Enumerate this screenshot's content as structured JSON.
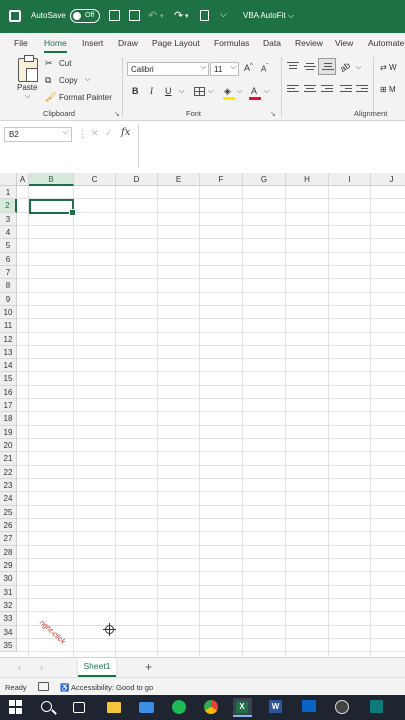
{
  "titlebar": {
    "autosave_label": "AutoSave",
    "autosave_state": "Off",
    "document_title": "VBA AutoFit ⌵"
  },
  "tabs": [
    {
      "label": "File",
      "active": false
    },
    {
      "label": "Home",
      "active": true
    },
    {
      "label": "Insert",
      "active": false
    },
    {
      "label": "Draw",
      "active": false
    },
    {
      "label": "Page Layout",
      "active": false
    },
    {
      "label": "Formulas",
      "active": false
    },
    {
      "label": "Data",
      "active": false
    },
    {
      "label": "Review",
      "active": false
    },
    {
      "label": "View",
      "active": false
    },
    {
      "label": "Automate",
      "active": false
    }
  ],
  "ribbon": {
    "clipboard": {
      "paste_label": "Paste",
      "cut_label": "Cut",
      "copy_label": "Copy",
      "format_painter_label": "Format Painter",
      "group_label": "Clipboard"
    },
    "font": {
      "font_name": "Calibri",
      "font_size": "11",
      "bold": "B",
      "italic": "I",
      "underline": "U",
      "font_color_letter": "A",
      "group_label": "Font"
    },
    "alignment": {
      "group_label": "Alignment",
      "wrap_label": "W",
      "merge_label": "M"
    }
  },
  "formula_bar": {
    "name_box": "B2",
    "fx_label": "fx",
    "formula": ""
  },
  "grid": {
    "columns": [
      "A",
      "B",
      "C",
      "D",
      "E",
      "F",
      "G",
      "H",
      "I",
      "J"
    ],
    "selected_column": "B",
    "rows": [
      "1",
      "2",
      "3",
      "4",
      "5",
      "6",
      "7",
      "8",
      "9",
      "10",
      "11",
      "12",
      "13",
      "14",
      "15",
      "16",
      "17",
      "18",
      "19",
      "20",
      "21",
      "22",
      "23",
      "24",
      "25",
      "26",
      "27",
      "28",
      "29",
      "30",
      "31",
      "32",
      "33",
      "34",
      "35"
    ],
    "selected_row": "2",
    "active_cell": "B2",
    "annotation": "right-click"
  },
  "sheets": {
    "tabs": [
      "Sheet1"
    ],
    "add_label": "+"
  },
  "status": {
    "ready": "Ready",
    "accessibility": "Accessibility: Good to go"
  },
  "colors": {
    "excel_green": "#1e7145",
    "annotation_red": "#c0392b"
  },
  "taskbar": {
    "icons": [
      "windows-icon",
      "search-icon",
      "task-view-icon",
      "file-explorer-icon",
      "mail-icon",
      "spotify-icon",
      "chrome-icon",
      "excel-icon",
      "word-icon",
      "outlook-icon",
      "obs-icon",
      "terminal-icon"
    ]
  }
}
